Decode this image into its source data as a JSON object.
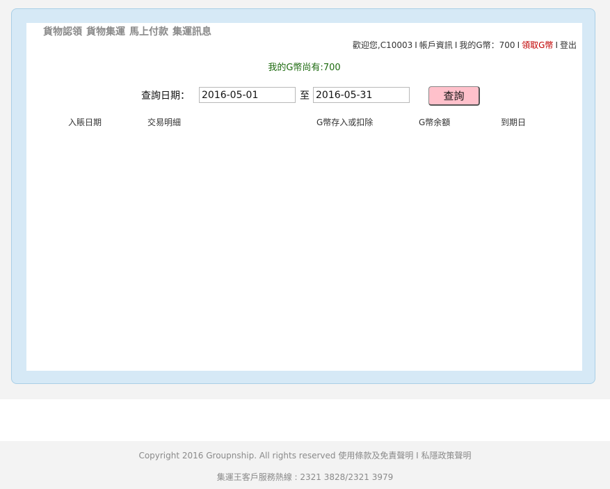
{
  "nav": {
    "items": [
      "貨物認領",
      "貨物集運",
      "馬上付款",
      "集運訊息"
    ]
  },
  "account": {
    "welcome": "歡迎您,C10003",
    "separator": "I",
    "account_info": "帳戶資訊",
    "my_coins": "我的G幣：700",
    "claim_coins": "領取G幣",
    "logout": "登出"
  },
  "balance": {
    "text": "我的G幣尚有:700"
  },
  "query": {
    "label": "查詢日期：",
    "date_from": "2016-05-01",
    "to_label": "至",
    "date_to": "2016-05-31",
    "button": "查詢"
  },
  "table": {
    "columns": [
      "入賬日期",
      "交易明細",
      "G幣存入或扣除",
      "G幣余額",
      "到期日"
    ],
    "rows": []
  },
  "footer": {
    "copyright": "Copyright 2016 Groupnship. All rights reserved",
    "terms": "使用條款及免責聲明",
    "separator": "I",
    "privacy": "私隱政策聲明",
    "hotline": "集運王客戶服務熱線 : 2321 3828/2321 3979"
  },
  "colors": {
    "frame_bg": "#d6e9f6",
    "frame_border": "#a9cfe6",
    "balance_text": "#1e6b10",
    "claim_link": "#c00000",
    "query_button": "#ffc1cb"
  }
}
